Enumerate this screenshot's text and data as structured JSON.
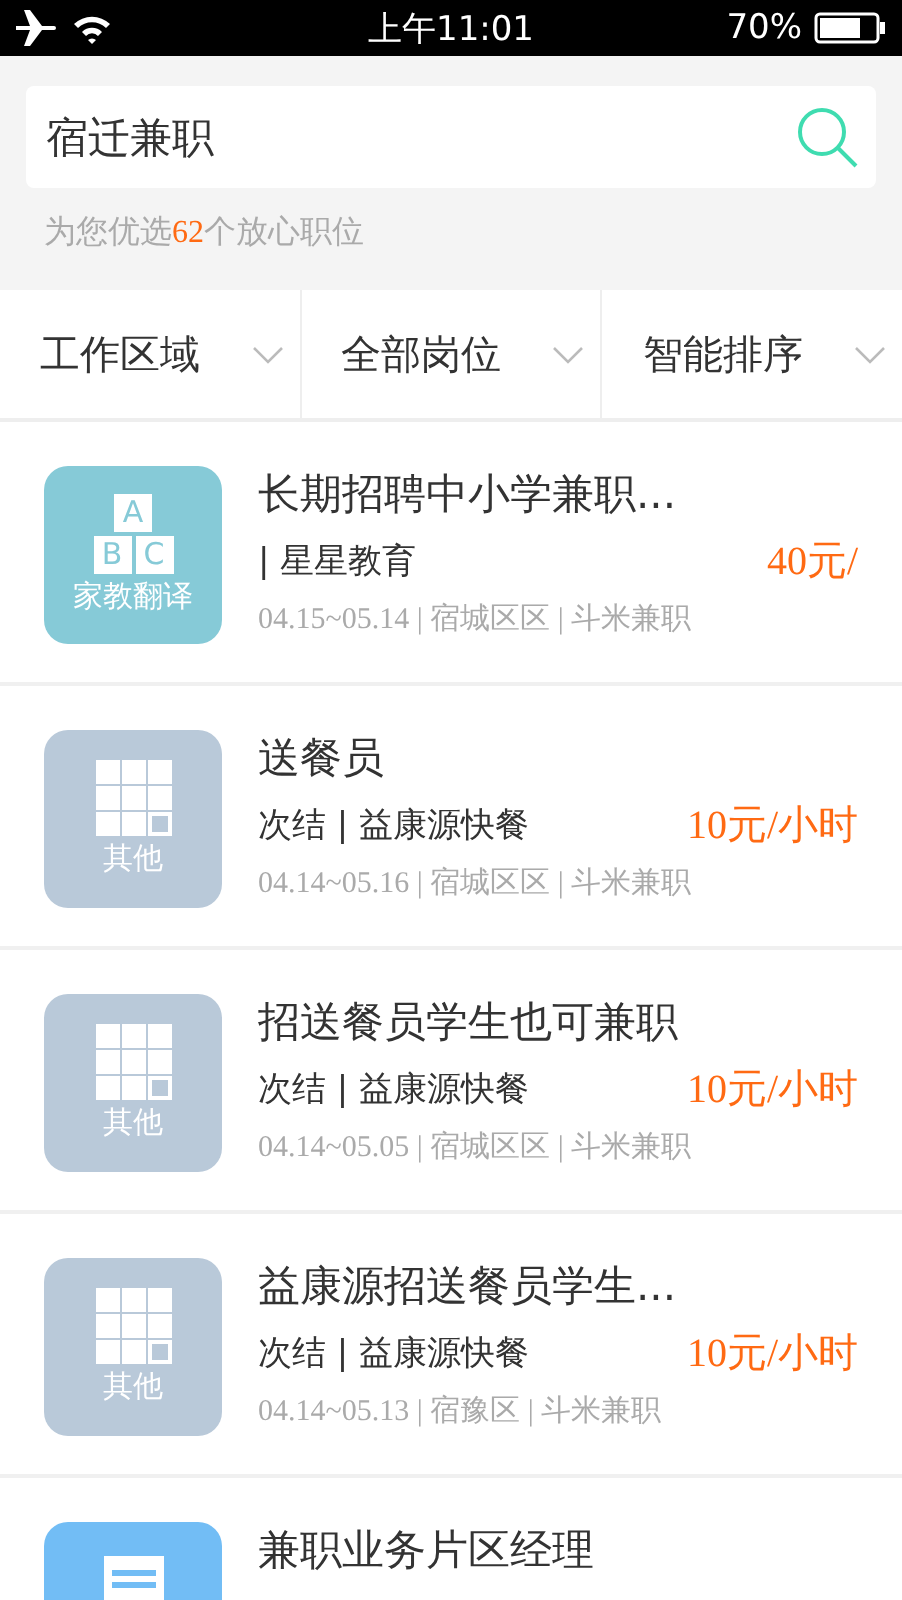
{
  "status_bar": {
    "time": "上午11:01",
    "battery": "70%"
  },
  "search": {
    "value": "宿迁兼职"
  },
  "summary": {
    "before": "为您优选",
    "count": "62",
    "after": "个放心职位"
  },
  "filters": [
    {
      "label": "工作区域"
    },
    {
      "label": "全部岗位"
    },
    {
      "label": "智能排序"
    }
  ],
  "jobs": [
    {
      "icon": {
        "kind": "abc",
        "letters": [
          "A",
          "B",
          "C"
        ],
        "label": "家教翻译",
        "color": "#86cad7"
      },
      "title": "长期招聘中小学兼职...",
      "company": "| 星星教育",
      "price": "40元/",
      "meta": "04.15~05.14 | 宿城区区 | 斗米兼职"
    },
    {
      "icon": {
        "kind": "grid",
        "label": "其他",
        "color": "#b9c9d9"
      },
      "title": "送餐员",
      "company": "次结 | 益康源快餐",
      "price": "10元/小时",
      "meta": "04.14~05.16 | 宿城区区 | 斗米兼职"
    },
    {
      "icon": {
        "kind": "grid",
        "label": "其他",
        "color": "#b9c9d9"
      },
      "title": "招送餐员学生也可兼职",
      "company": "次结 | 益康源快餐",
      "price": "10元/小时",
      "meta": "04.14~05.05 | 宿城区区 | 斗米兼职"
    },
    {
      "icon": {
        "kind": "grid",
        "label": "其他",
        "color": "#b9c9d9"
      },
      "title": "益康源招送餐员学生...",
      "company": "次结 | 益康源快餐",
      "price": "10元/小时",
      "meta": "04.14~05.13 | 宿豫区 | 斗米兼职"
    },
    {
      "icon": {
        "kind": "doc",
        "color": "#72bdf5"
      },
      "title": "兼职业务片区经理"
    }
  ]
}
